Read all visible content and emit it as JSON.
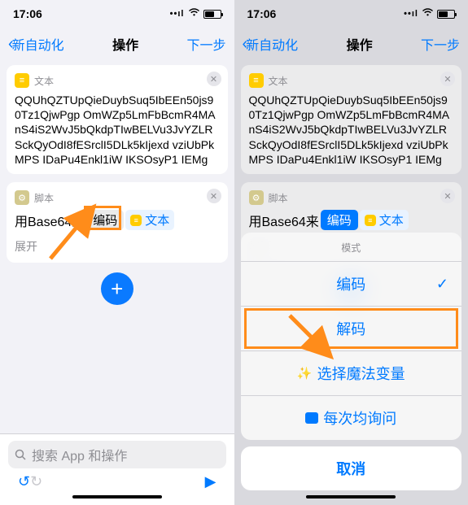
{
  "statusbar": {
    "time": "17:06"
  },
  "nav": {
    "back": "新自动化",
    "title": "操作",
    "next": "下一步"
  },
  "text_card": {
    "label": "文本",
    "content": "QQUhQZTUpQieDuybSuq5IbEEn50js90Tz1QjwPgp\nOmWZp5LmFbBcmR4MAnS4iS2WvJ5bQkdpTIwBELVu3JvYZLRSckQyOdI8fESrclI5DLk5kIjexd\nvziUbPkMPS IDaPu4Enkl1iW IKSOsyP1 IEMg"
  },
  "script_card": {
    "label": "脚本",
    "prefix": "用Base64来",
    "mode": "编码",
    "input_token": "文本",
    "expand": "展开"
  },
  "search": {
    "placeholder": "搜索 App 和操作"
  },
  "sheet": {
    "title": "模式",
    "encode": "编码",
    "decode": "解码",
    "magic": "选择魔法变量",
    "ask": "每次均询问",
    "cancel": "取消"
  }
}
